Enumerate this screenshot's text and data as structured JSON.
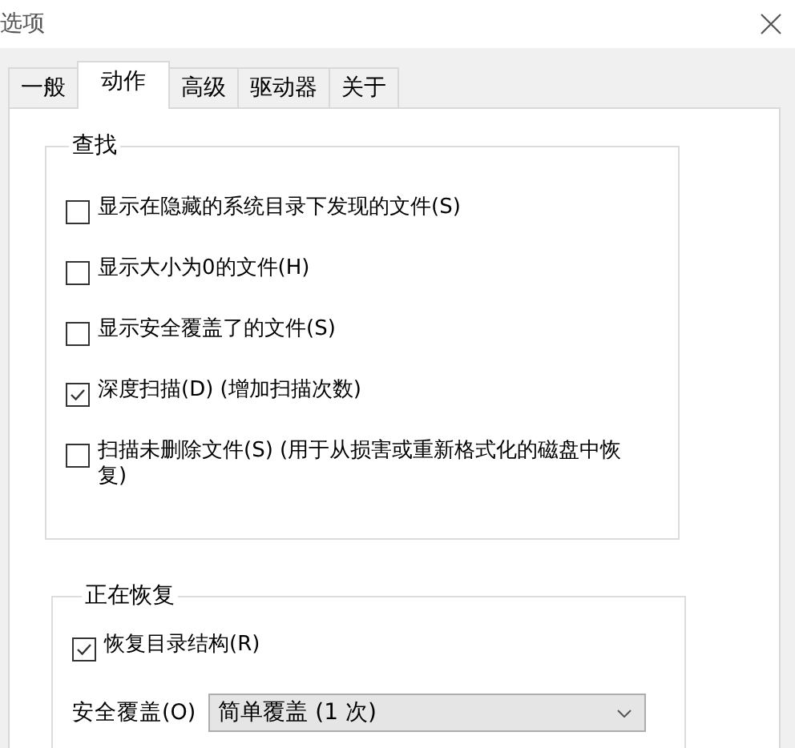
{
  "window": {
    "title": "选项"
  },
  "tabs": [
    {
      "label": "一般",
      "selected": false
    },
    {
      "label": "动作",
      "selected": true
    },
    {
      "label": "高级",
      "selected": false
    },
    {
      "label": "驱动器",
      "selected": false
    },
    {
      "label": "关于",
      "selected": false
    }
  ],
  "groups": [
    {
      "title": "查找",
      "items": [
        {
          "kind": "checkbox",
          "label": "显示在隐藏的系统目录下发现的文件(S)",
          "checked": false
        },
        {
          "kind": "checkbox",
          "label": "显示大小为0的文件(H)",
          "checked": false
        },
        {
          "kind": "checkbox",
          "label": "显示安全覆盖了的文件(S)",
          "checked": false
        },
        {
          "kind": "checkbox",
          "label": "深度扫描(D) (增加扫描次数)",
          "checked": true
        },
        {
          "kind": "checkbox",
          "label": "扫描未删除文件(S) (用于从损害或重新格式化的磁盘中恢复)",
          "checked": false
        }
      ]
    },
    {
      "title": "正在恢复",
      "items": [
        {
          "kind": "checkbox",
          "label": "恢复目录结构(R)",
          "checked": true
        },
        {
          "kind": "dropdown",
          "label": "安全覆盖(O)",
          "value": "简单覆盖 (1 次)"
        }
      ]
    }
  ]
}
